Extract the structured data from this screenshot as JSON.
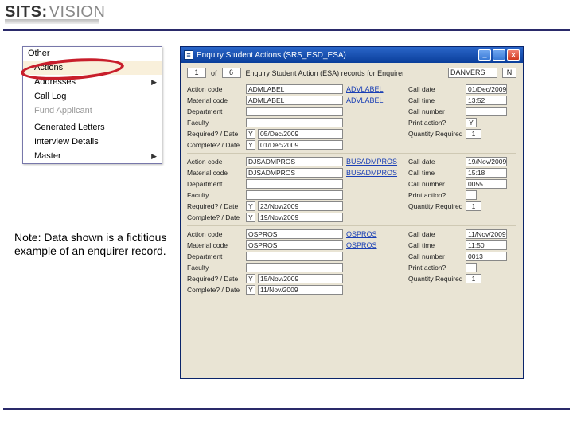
{
  "logo": {
    "part1": "SITS:",
    "part2": "VISION"
  },
  "menu": {
    "header": "Other",
    "items": [
      {
        "label": "Actions",
        "arrow": false,
        "sel": true
      },
      {
        "label": "Addresses",
        "arrow": true
      },
      {
        "label": "Call Log",
        "arrow": false
      },
      {
        "label": "Fund Applicant",
        "arrow": false,
        "dim": true
      },
      {
        "label": "Generated Letters",
        "arrow": false
      },
      {
        "label": "Interview Details",
        "arrow": false
      },
      {
        "label": "Master",
        "arrow": true
      }
    ]
  },
  "note": "Note: Data shown is a fictitious example of an enquirer record.",
  "window": {
    "title": "Enquiry Student Actions (SRS_ESD_ESA)",
    "header": {
      "pos": "1",
      "of_lbl": "of",
      "total": "6",
      "desc": "Enquiry Student Action (ESA) records for Enquirer",
      "name": "DANVERS",
      "init": "N"
    },
    "labels": {
      "action": "Action code",
      "material": "Material code",
      "dept": "Department",
      "faculty": "Faculty",
      "req": "Required? / Date",
      "comp": "Complete? / Date",
      "cdate": "Call date",
      "ctime": "Call time",
      "cnum": "Call number",
      "print": "Print action?",
      "qty": "Quantity Required"
    },
    "blocks": [
      {
        "action": "ADMLABEL",
        "action_link": "ADVLABEL",
        "material": "ADMLABEL",
        "material_link": "ADVLABEL",
        "req_y": "Y",
        "req_date": "05/Dec/2009",
        "comp_y": "Y",
        "comp_date": "01/Dec/2009",
        "cdate": "01/Dec/2009",
        "ctime": "13:52",
        "cnum": "",
        "print": "Y",
        "qty": "1"
      },
      {
        "action": "DJSADMPROS",
        "action_link": "BUSADMPROS",
        "material": "DJSADMPROS",
        "material_link": "BUSADMPROS",
        "req_y": "Y",
        "req_date": "23/Nov/2009",
        "comp_y": "Y",
        "comp_date": "19/Nov/2009",
        "cdate": "19/Nov/2009",
        "ctime": "15:18",
        "cnum": "0055",
        "print": "",
        "qty": "1"
      },
      {
        "action": "OSPROS",
        "action_link": "OSPROS",
        "material": "OSPROS",
        "material_link": "OSPROS",
        "req_y": "Y",
        "req_date": "15/Nov/2009",
        "comp_y": "Y",
        "comp_date": "11/Nov/2009",
        "cdate": "11/Nov/2009",
        "ctime": "11:50",
        "cnum": "0013",
        "print": "",
        "qty": "1"
      }
    ]
  }
}
